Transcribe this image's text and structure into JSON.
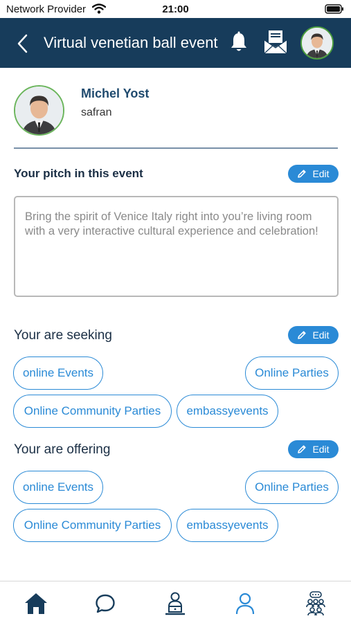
{
  "status_bar": {
    "provider": "Network Provider",
    "time": "21:00"
  },
  "header": {
    "title": "Virtual venetian ball event"
  },
  "profile": {
    "name": "Michel Yost",
    "company": "safran"
  },
  "pitch": {
    "title": "Your pitch in this event",
    "edit_label": "Edit",
    "text": "Bring the spirit of Venice Italy right into you’re living room with a very interactive cultural experience and celebration!"
  },
  "seeking": {
    "title": "Your are seeking",
    "edit_label": "Edit",
    "tags": [
      "online Events",
      "Online Parties",
      "Online Community Parties",
      "embassyevents"
    ]
  },
  "offering": {
    "title": "Your are offering",
    "edit_label": "Edit",
    "tags": [
      "online Events",
      "Online Parties",
      "Online Community Parties",
      "embassyevents"
    ]
  },
  "bottom_nav": {
    "items": [
      {
        "icon": "home-icon",
        "active": true
      },
      {
        "icon": "chat-icon",
        "active": false
      },
      {
        "icon": "speaker-icon",
        "active": false
      },
      {
        "icon": "profile-icon",
        "active": false
      },
      {
        "icon": "community-icon",
        "active": false
      }
    ]
  },
  "colors": {
    "header_bg": "#173c5b",
    "accent": "#2a8ad6",
    "avatar_ring": "#4b9e3e",
    "title_text": "#1b2f45"
  }
}
